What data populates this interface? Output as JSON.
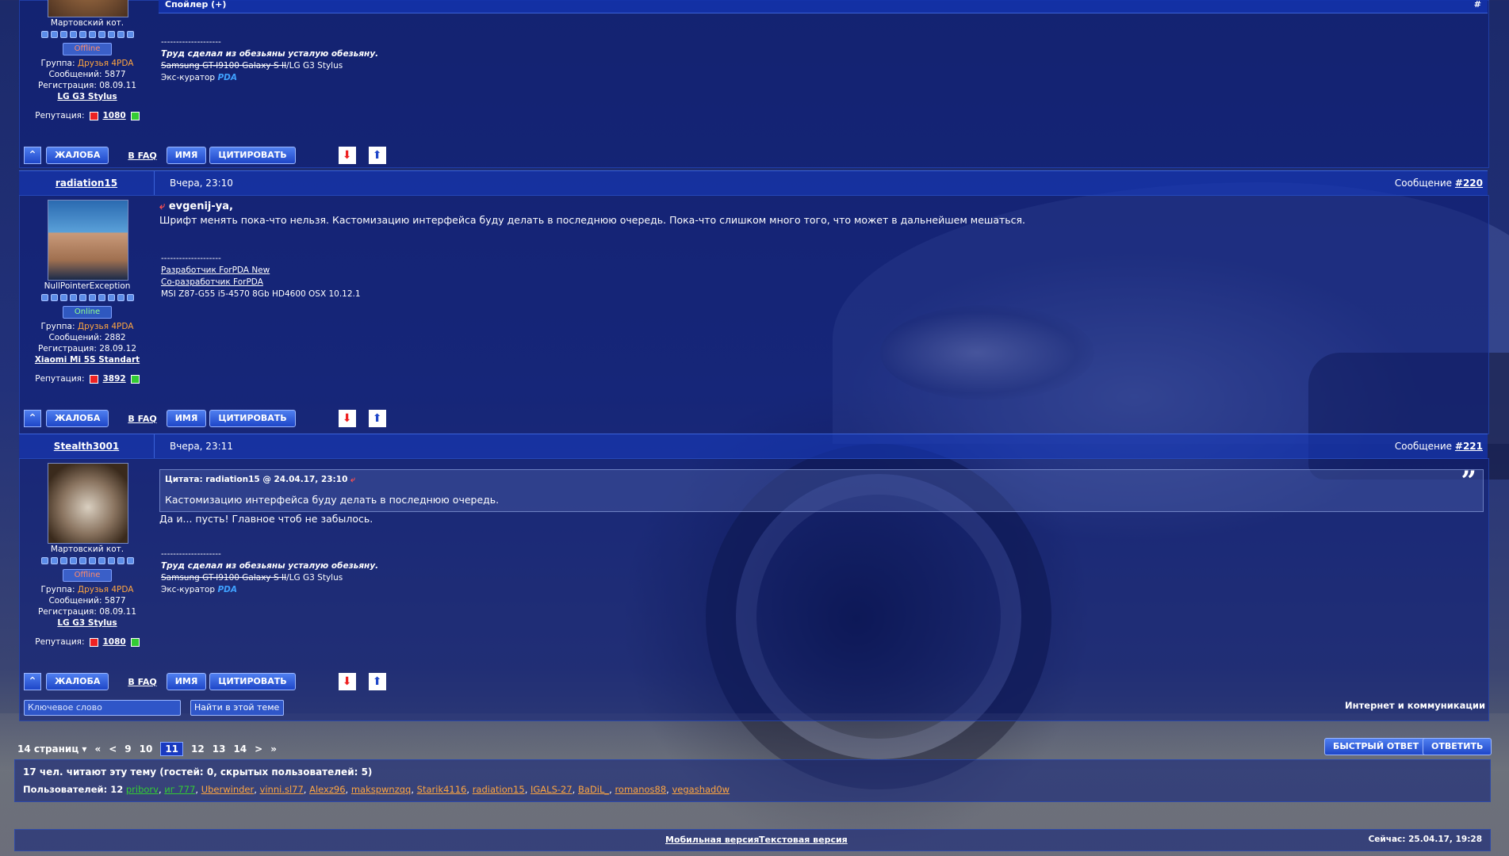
{
  "post1": {
    "spoiler_label": "Спойлер (+)",
    "hash": "#",
    "user_title": "Мартовский кот.",
    "status": "Offline",
    "group_label": "Группа:",
    "group": "Друзья 4PDA",
    "messages": "Сообщений: 5877",
    "registered": "Регистрация: 08.09.11",
    "device": "LG G3 Stylus",
    "rep_label": "Репутация:",
    "rep": "1080",
    "sig_divider": "--------------------",
    "sig_line1": "Труд сделал из обезьяны усталую обезьяну.",
    "sig_line2_strike": "Samsung GT-I9100 Galaxy S II",
    "sig_line2_rest": "/LG G3 Stylus",
    "sig_line3": "Экс-куратор",
    "sig_logo": "PDA"
  },
  "post2": {
    "author": "radiation15",
    "date": "Вчера, 23:10",
    "msg_label": "Сообщение",
    "msg_num": "#220",
    "user_title": "NullPointerException",
    "status": "Online",
    "group_label": "Группа:",
    "group": "Друзья 4PDA",
    "messages": "Сообщений: 2882",
    "registered": "Регистрация: 28.09.12",
    "device": "Xiaomi Mi 5S Standart",
    "rep_label": "Репутация:",
    "rep": "3892",
    "reply_to": "evgenij-ya,",
    "text": "Шрифт менять пока-что нельзя. Кастомизацию интерфейса буду делать в последнюю очередь. Пока-что слишком много того, что может в дальнейшем мешаться.",
    "sig_divider": "--------------------",
    "sig_link1": "Разработчик ForPDA New",
    "sig_link2": "Со-разработчик ForPDA",
    "sig_line3": "MSI Z87-G55 i5-4570 8Gb HD4600 OSX 10.12.1"
  },
  "post3": {
    "author": "Stealth3001",
    "date": "Вчера, 23:11",
    "msg_label": "Сообщение",
    "msg_num": "#221",
    "user_title": "Мартовский кот.",
    "status": "Offline",
    "group_label": "Группа:",
    "group": "Друзья 4PDA",
    "messages": "Сообщений: 5877",
    "registered": "Регистрация: 08.09.11",
    "device": "LG G3 Stylus",
    "rep_label": "Репутация:",
    "rep": "1080",
    "quote_header": "Цитата: radiation15 @ 24.04.17, 23:10",
    "quote_text": "Кастомизацию интерфейса буду делать в последнюю очередь.",
    "text": "Да и... пусть! Главное чтоб не забылось.",
    "sig_divider": "--------------------",
    "sig_line1": "Труд сделал из обезьяны усталую обезьяну.",
    "sig_line2_strike": "Samsung GT-I9100 Galaxy S II",
    "sig_line2_rest": "/LG G3 Stylus",
    "sig_line3": "Экс-куратор",
    "sig_logo": "PDA"
  },
  "buttons": {
    "complain": "ЖАЛОБА",
    "faq": "В FAQ",
    "name": "ИМЯ",
    "quote": "ЦИТИРОВАТЬ"
  },
  "search": {
    "keyword_placeholder": "Ключевое слово",
    "find_button": "Найти в этой теме",
    "category": "Интернет и коммуникации"
  },
  "pager": {
    "pages_label": "14 страниц ▾",
    "first": "«",
    "prev": "<",
    "p9": "9",
    "p10": "10",
    "p11": "11",
    "p12": "12",
    "p13": "13",
    "p14": "14",
    "next": ">",
    "last": "»"
  },
  "actions": {
    "quick_reply": "БЫСТРЫЙ ОТВЕТ",
    "reply": "ОТВЕТИТЬ"
  },
  "readers": {
    "title": "17 чел. читают эту тему (гостей: 0, скрытых пользователей: 5)",
    "users_label": "Пользователей: 12",
    "users": [
      {
        "name": "priborv",
        "color": "#33cc33"
      },
      {
        "name": "иг 777",
        "color": "#33cc33"
      },
      {
        "name": "Uberwinder",
        "color": "#ffa640"
      },
      {
        "name": "vinni.sl77",
        "color": "#ffa640"
      },
      {
        "name": "Alexz96",
        "color": "#ffa640"
      },
      {
        "name": "makspwnzqq",
        "color": "#ffa640"
      },
      {
        "name": "Starik4116",
        "color": "#ffa640"
      },
      {
        "name": "radiation15",
        "color": "#ffa640"
      },
      {
        "name": "IGALS-27",
        "color": "#ffa640"
      },
      {
        "name": "BaDiL_",
        "color": "#ffa640"
      },
      {
        "name": "romanos88",
        "color": "#ffa640"
      },
      {
        "name": "vegashad0w",
        "color": "#ffa640"
      }
    ]
  },
  "footer": {
    "mobile": "Мобильная версия",
    "text": "Текстовая версия",
    "now": "Сейчас: 25.04.17, 19:28"
  }
}
